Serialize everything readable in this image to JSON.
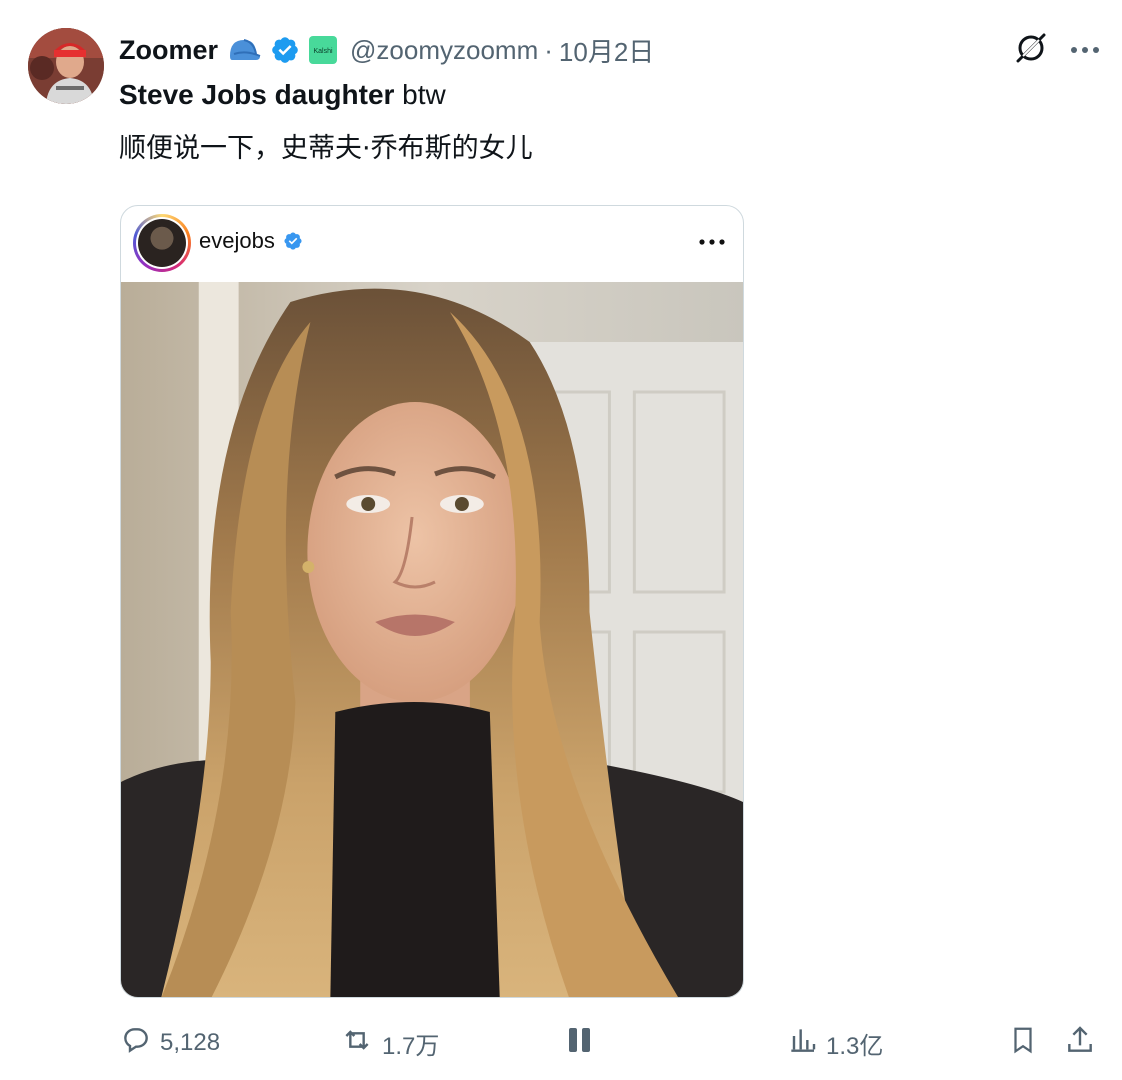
{
  "author": {
    "display_name": "Zoomer",
    "badge_label": "Kalshi",
    "handle": "@zoomyzoomm",
    "separator": "·",
    "date": "10月2日"
  },
  "tweet": {
    "bold_text": "Steve Jobs daughter",
    "rest_text": " btw",
    "translation": "顺便说一下，史蒂夫·乔布斯的女儿"
  },
  "embedded_post": {
    "username": "evejobs"
  },
  "metrics": {
    "replies": "5,128",
    "reposts": "1.7万",
    "views": "1.3亿"
  },
  "icons": {
    "hat": "cap-icon",
    "verified": "verified-badge-icon",
    "grok": "grok-icon",
    "more": "more-icon",
    "reply": "reply-icon",
    "repost": "repost-icon",
    "like": "like-icon",
    "views": "views-icon",
    "bookmark": "bookmark-icon",
    "share": "share-icon"
  },
  "colors": {
    "verified_blue": "#1d9bf0",
    "secondary_text": "#536471",
    "border": "#cfd9de"
  }
}
